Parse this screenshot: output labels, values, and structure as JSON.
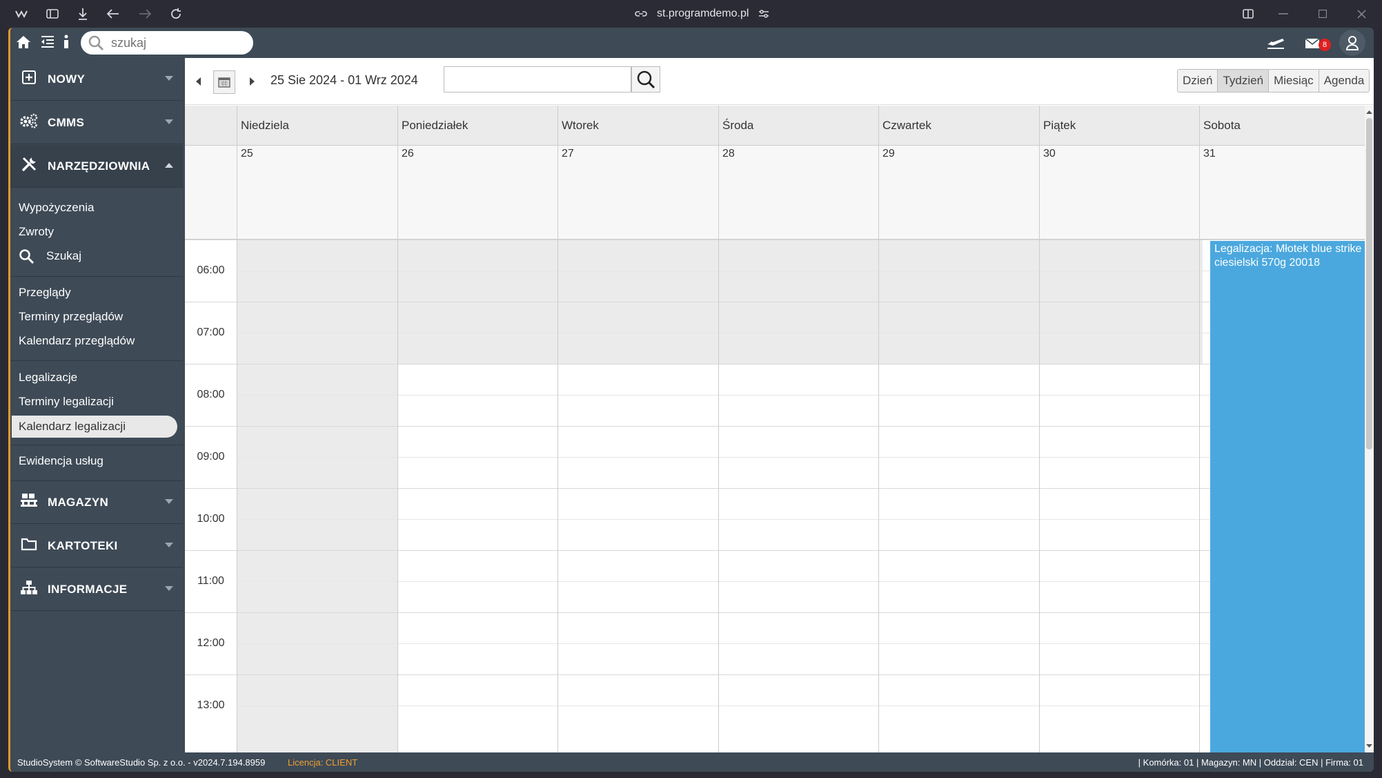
{
  "browser": {
    "url": "st.programdemo.pl"
  },
  "topbar": {
    "search_placeholder": "szukaj",
    "mail_count": "8"
  },
  "sidebar": {
    "sections": {
      "nowy": "NOWY",
      "cmms": "CMMS",
      "narzedziownia": "NARZĘDZIOWNIA",
      "magazyn": "MAGAZYN",
      "kartoteki": "KARTOTEKI",
      "informacje": "INFORMACJE"
    },
    "items": {
      "wypozyczenia": "Wypożyczenia",
      "zwroty": "Zwroty",
      "szukaj": "Szukaj",
      "przeglady": "Przeglądy",
      "terminy_przegladow": "Terminy przeglądów",
      "kalendarz_przegladow": "Kalendarz przeglądów",
      "legalizacje": "Legalizacje",
      "terminy_legalizacji": "Terminy legalizacji",
      "kalendarz_legalizacji": "Kalendarz legalizacji",
      "ewidencja_uslug": "Ewidencja usług"
    }
  },
  "calendar": {
    "date_range": "25 Sie 2024 - 01 Wrz 2024",
    "views": [
      "Dzień",
      "Tydzień",
      "Miesiąc",
      "Agenda"
    ],
    "active_view": "Tydzień",
    "days": [
      {
        "name": "Niedziela",
        "num": "25"
      },
      {
        "name": "Poniedziałek",
        "num": "26"
      },
      {
        "name": "Wtorek",
        "num": "27"
      },
      {
        "name": "Środa",
        "num": "28"
      },
      {
        "name": "Czwartek",
        "num": "29"
      },
      {
        "name": "Piątek",
        "num": "30"
      },
      {
        "name": "Sobota",
        "num": "31"
      }
    ],
    "hours": [
      "06:00",
      "07:00",
      "08:00",
      "09:00",
      "10:00",
      "11:00",
      "12:00",
      "13:00"
    ],
    "event": {
      "title": "Legalizacja: Młotek blue strike ciesielski 570g 20018",
      "color": "#4ba8de"
    }
  },
  "status": {
    "left": "StudioSystem © SoftwareStudio Sp. z o.o. - v2024.7.194.8959",
    "license": "Licencja: CLIENT",
    "right": "| Komórka: 01 | Magazyn: MN | Oddział: CEN | Firma: 01"
  }
}
